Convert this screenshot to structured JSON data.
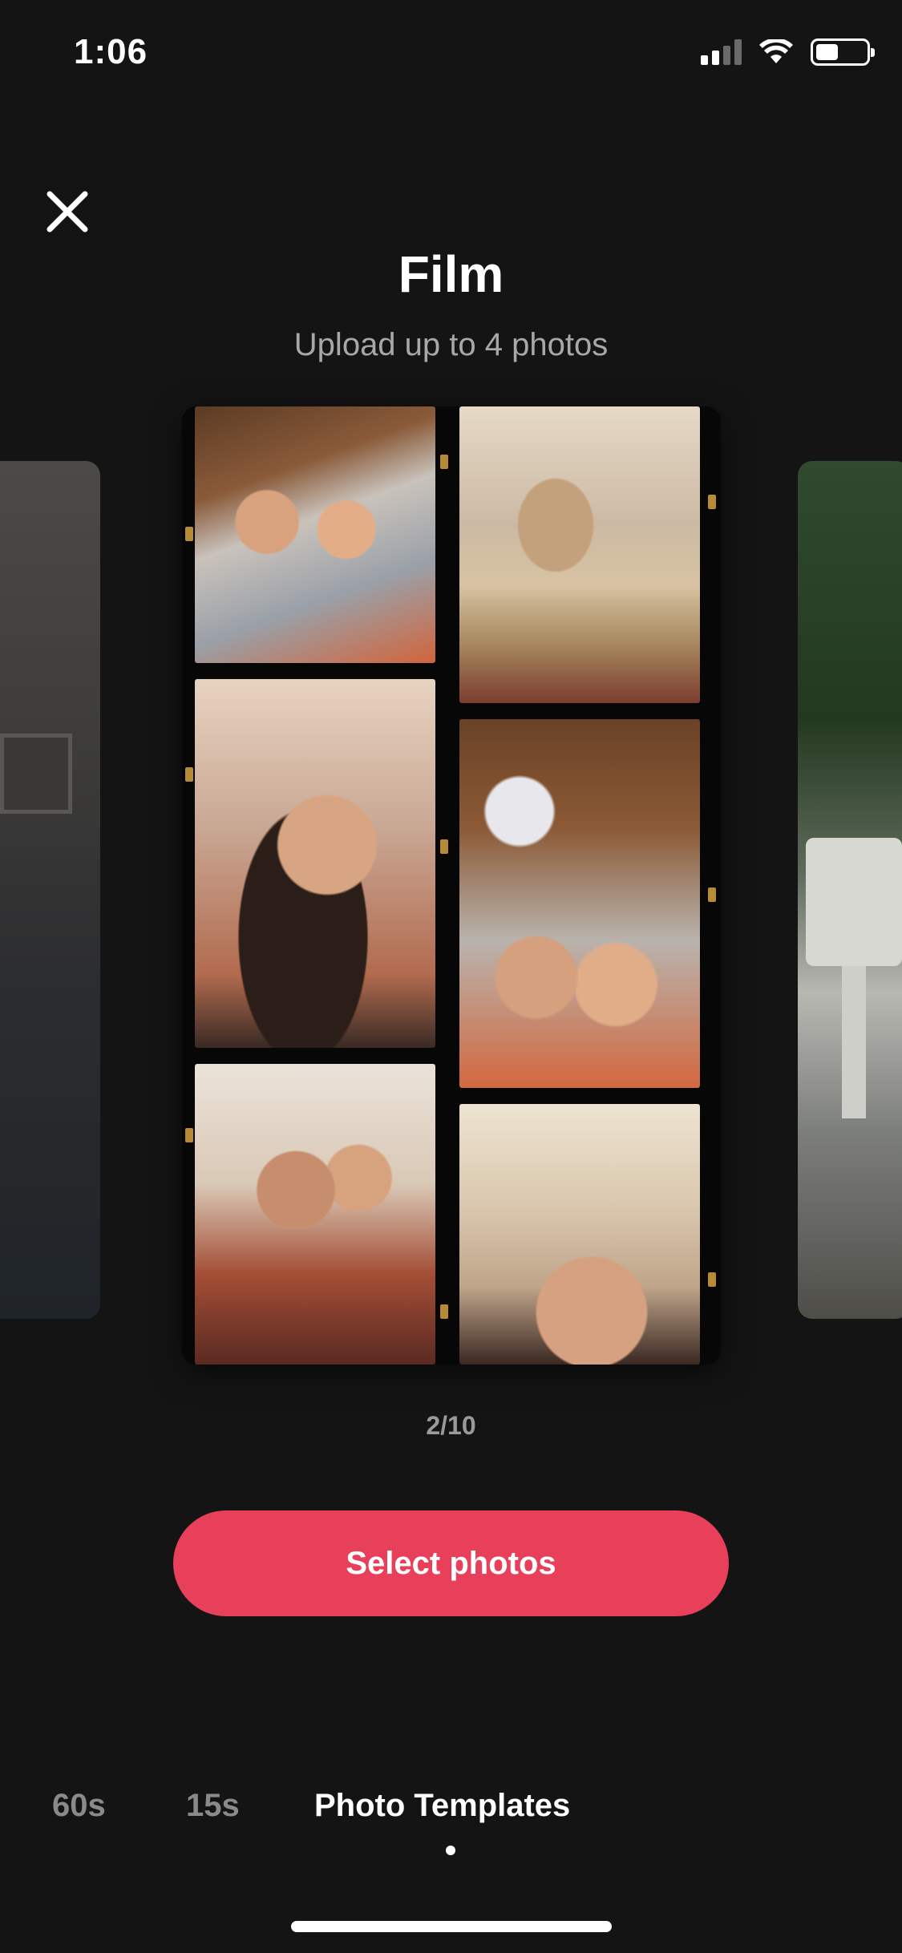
{
  "status_bar": {
    "time": "1:06",
    "battery_level": 0.45
  },
  "header": {
    "title": "Film",
    "subtitle": "Upload up to 4 photos"
  },
  "carousel": {
    "page_indicator": "2/10"
  },
  "actions": {
    "select_label": "Select photos"
  },
  "tabs": [
    {
      "label": "60s",
      "active": false
    },
    {
      "label": "15s",
      "active": false
    },
    {
      "label": "Photo Templates",
      "active": true
    }
  ],
  "colors": {
    "accent": "#e8405a",
    "background": "#141414"
  },
  "icons": {
    "close": "close-icon",
    "wifi": "wifi-icon",
    "signal": "signal-icon",
    "battery": "battery-icon"
  }
}
